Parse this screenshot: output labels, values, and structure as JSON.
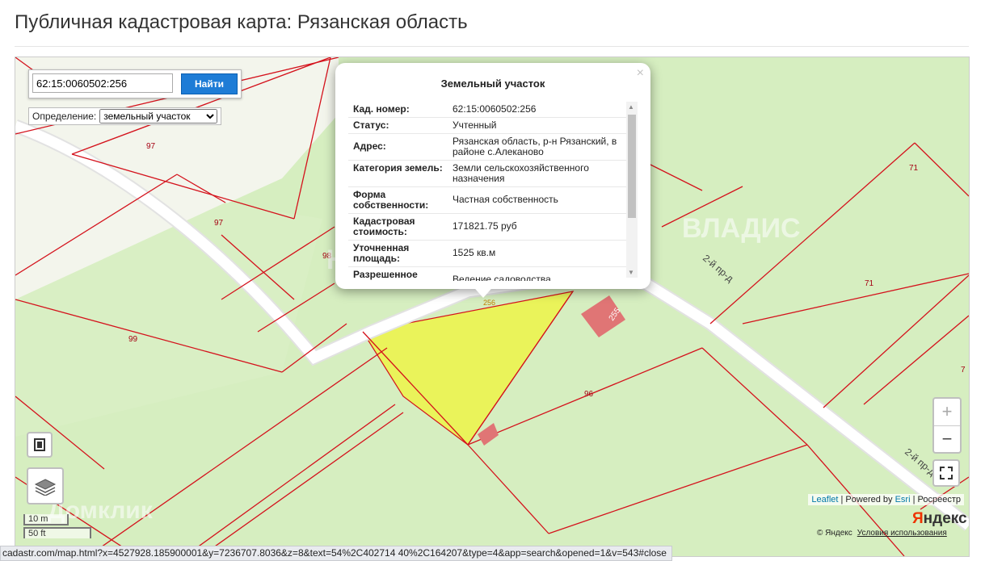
{
  "page": {
    "title": "Публичная кадастровая карта: Рязанская область"
  },
  "search": {
    "value": "62:15:0060502:256",
    "button_label": "Найти"
  },
  "definition": {
    "label": "Определение:",
    "selected": "земельный участок"
  },
  "popup": {
    "title": "Земельный участок",
    "close": "×",
    "rows": [
      {
        "key": "Кад. номер:",
        "value": "62:15:0060502:256"
      },
      {
        "key": "Статус:",
        "value": "Учтенный"
      },
      {
        "key": "Адрес:",
        "value": "Рязанская область, р-н Рязанский, в районе с.Алеканово"
      },
      {
        "key": "Категория земель:",
        "value": "Земли сельскохозяйственного назначения"
      },
      {
        "key": "Форма собственности:",
        "value": "Частная собственность"
      },
      {
        "key": "Кадастровая стоимость:",
        "value": "171821.75 руб"
      },
      {
        "key": "Уточненная площадь:",
        "value": "1525 кв.м"
      },
      {
        "key": "Разрешенное",
        "value": "Ведение садоводства"
      }
    ]
  },
  "map": {
    "parcel_labels": [
      "97",
      "97",
      "98",
      "99",
      "256",
      "255",
      "96",
      "71",
      "71",
      "7"
    ],
    "street_labels": [
      "2-й пр-д",
      "2-й пр-д"
    ],
    "scale": {
      "metric": "10 m",
      "imperial": "50 ft"
    },
    "colors": {
      "background": "#d6eec0",
      "boundary": "#d4121c",
      "selected_parcel": "#eaf35a",
      "building": "#e07575",
      "road": "#ffffff"
    }
  },
  "controls": {
    "zoom_in": "+",
    "zoom_out": "−"
  },
  "attribution": {
    "leaflet": "Leaflet",
    "powered_by": "Powered by",
    "esri": "Esri",
    "rosreestr": "Росреестр"
  },
  "yandex": {
    "logo_first": "Я",
    "logo_rest": "ндекс",
    "copyright": "© Яндекс",
    "terms": "Условия использования"
  },
  "watermarks": {
    "vladis_line1": "ВЛАДИС",
    "vladis_line2": "НЕДВИЖИМОСТИ",
    "domclick": "Домклик"
  },
  "status_bar": {
    "url": "cadastr.com/map.html?x=4527928.185900001&y=7236707.8036&z=8&text=54%2C402714 40%2C164207&type=4&app=search&opened=1&v=543#close"
  }
}
